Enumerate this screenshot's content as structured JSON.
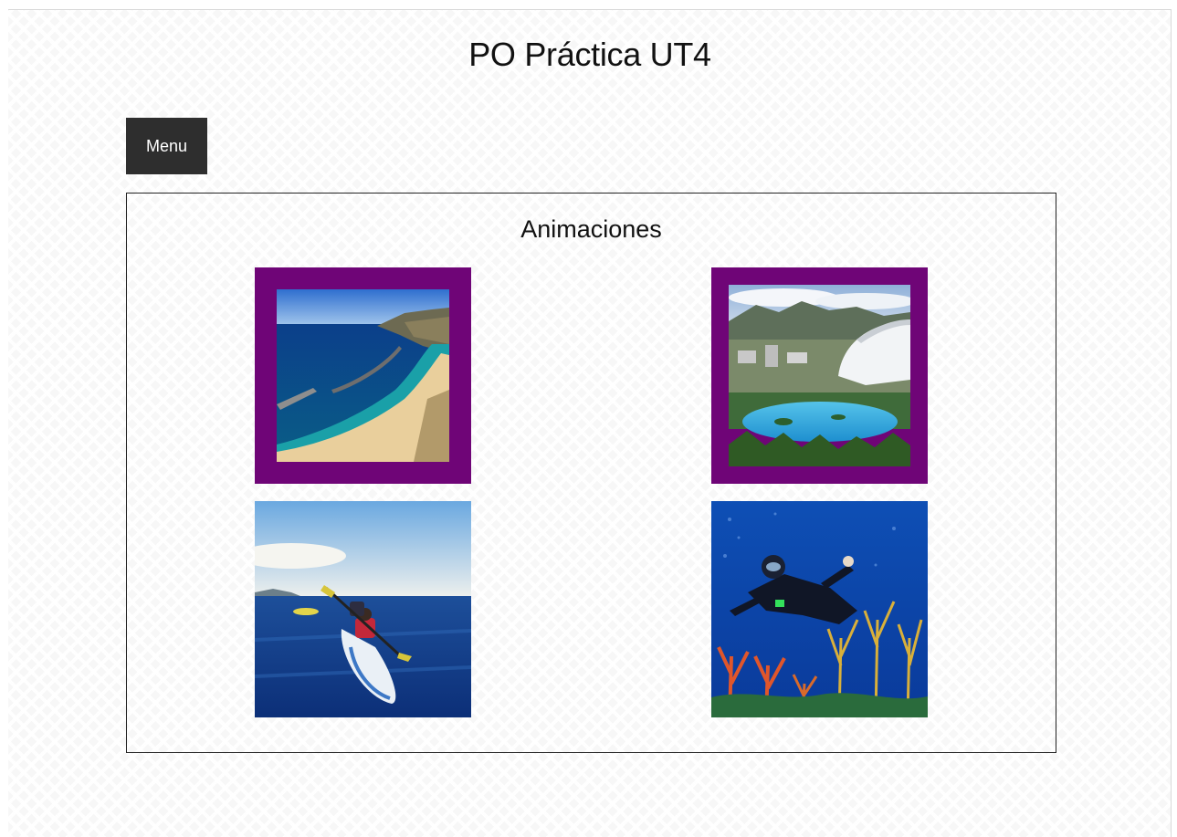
{
  "page": {
    "title": "PO Práctica UT4"
  },
  "nav": {
    "menu_label": "Menu"
  },
  "section": {
    "heading": "Animaciones"
  },
  "gallery": {
    "frame_color": "#6f0577",
    "images": [
      {
        "subject": "beach-photo",
        "framed": true
      },
      {
        "subject": "auditorium-city-photo",
        "framed": true
      },
      {
        "subject": "kayak-photo",
        "framed": false
      },
      {
        "subject": "diver-reef-photo",
        "framed": false
      }
    ]
  }
}
